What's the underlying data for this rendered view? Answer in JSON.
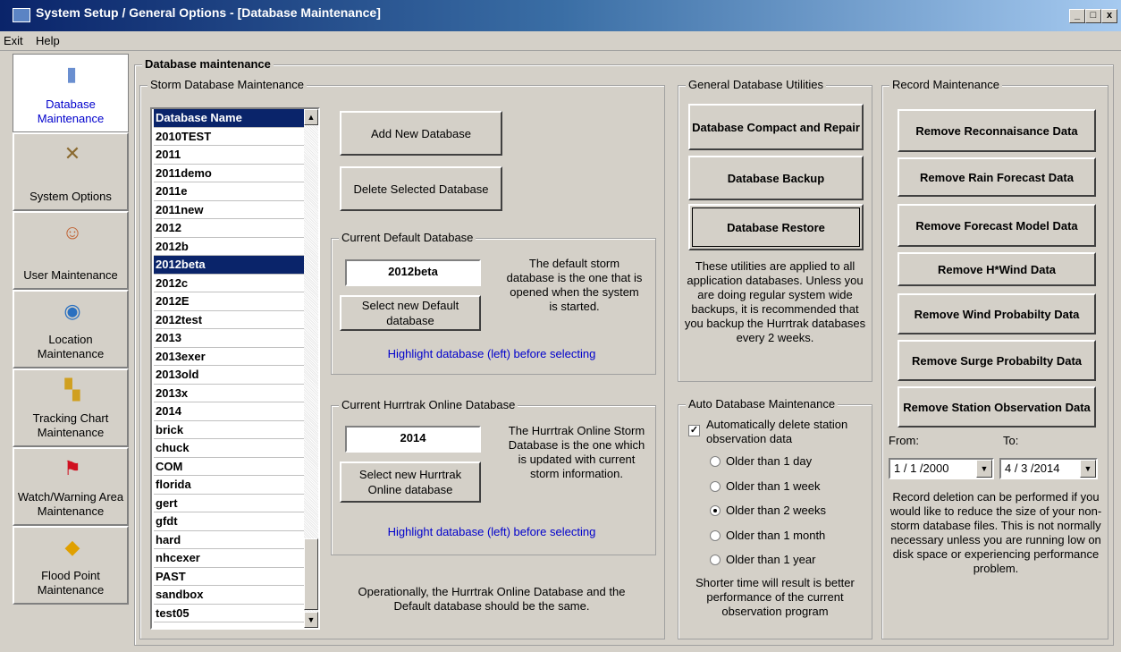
{
  "window": {
    "title": "System Setup / General Options - [Database Maintenance]",
    "min": "_",
    "max": "□",
    "close": "x"
  },
  "menu": [
    "Exit",
    "Help"
  ],
  "nav": [
    {
      "label": "Database Maintenance",
      "icon": "database-icon",
      "glyph": "▮"
    },
    {
      "label": "System Options",
      "icon": "tools-icon",
      "glyph": "✕"
    },
    {
      "label": "User Maintenance",
      "icon": "users-icon",
      "glyph": "☺"
    },
    {
      "label": "Location Maintenance",
      "icon": "globe-icon",
      "glyph": "◉"
    },
    {
      "label": "Tracking Chart Maintenance",
      "icon": "map-icon",
      "glyph": "▚"
    },
    {
      "label": "Watch/Warning Area Maintenance",
      "icon": "flag-icon",
      "glyph": "⚑"
    },
    {
      "label": "Flood Point Maintenance",
      "icon": "flood-sign-icon",
      "glyph": "◆"
    }
  ],
  "main_title": "Database maintenance",
  "storm": {
    "legend": "Storm Database Maintenance",
    "list_header": "Database Name",
    "items": [
      "2010TEST",
      "2011",
      "2011demo",
      "2011e",
      "2011new",
      "2012",
      "2012b",
      "2012beta",
      "2012c",
      "2012E",
      "2012test",
      "2013",
      "2013exer",
      "2013old",
      "2013x",
      "2014",
      "brick",
      "chuck",
      "COM",
      "florida",
      "gert",
      "gfdt",
      "hard",
      "nhcexer",
      "PAST",
      "sandbox",
      "test05"
    ],
    "selected": "2012beta",
    "add_button": "Add New Database",
    "delete_button": "Delete Selected Database",
    "default": {
      "legend": "Current Default Database",
      "value": "2012beta",
      "info": "The default storm database is the one that is opened when the system is started.",
      "select_button": "Select new Default database",
      "hint": "Highlight database (left) before selecting"
    },
    "online": {
      "legend": "Current Hurrtrak Online Database",
      "value": "2014",
      "info": "The Hurrtrak Online Storm Database is the one which is updated with current storm information.",
      "select_button": "Select new Hurrtrak Online database",
      "hint": "Highlight database (left) before selecting"
    },
    "note": "Operationally, the Hurrtrak Online Database and the Default database should be the same."
  },
  "general": {
    "legend": "General Database Utilities",
    "compact_button": "Database Compact and Repair",
    "backup_button": "Database Backup",
    "restore_button": "Database Restore",
    "info": "These utilities are applied to all application databases. Unless you are doing regular system wide backups, it is recommended that you backup the Hurrtrak databases every 2 weeks."
  },
  "auto": {
    "legend": "Auto Database Maintenance",
    "checkbox_label": "Automatically delete station observation data",
    "checked": true,
    "options": [
      "Older than 1 day",
      "Older than 1 week",
      "Older than 2 weeks",
      "Older than 1 month",
      "Older than 1 year"
    ],
    "selected_index": 2,
    "note": "Shorter time will result is better performance of the current observation program"
  },
  "record": {
    "legend": "Record Maintenance",
    "buttons": [
      "Remove Reconnaisance Data",
      "Remove Rain Forecast Data",
      "Remove Forecast Model Data",
      "Remove H*Wind Data",
      "Remove Wind Probabilty Data",
      "Remove Surge Probabilty Data",
      "Remove Station Observation Data"
    ],
    "from_label": "From:",
    "to_label": "To:",
    "from_value": "1 / 1 /2000",
    "to_value": "4 / 3 /2014",
    "note": "Record deletion can be performed if you would like to reduce the size of your non-storm database files. This is not normally necessary unless you are running low on disk space or experiencing performance problem."
  }
}
